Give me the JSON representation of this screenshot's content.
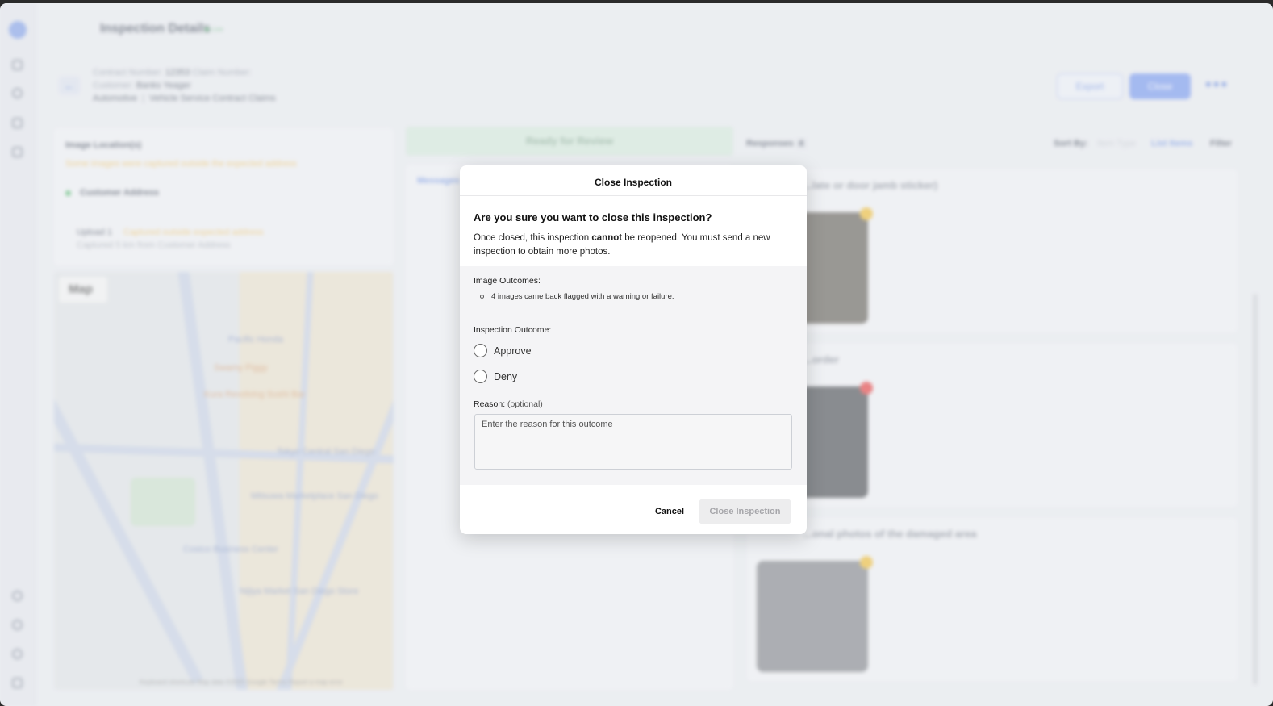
{
  "header": {
    "title": "Inspection Details",
    "live_badge": "Live",
    "contract_number_label": "Contract Number:",
    "contract_number": "12353",
    "claim_number_label": "Claim Number:",
    "customer_label": "Customer:",
    "customer_name": "Banks Yeager",
    "category": "Automotive",
    "program": "Vehicle Service Contract Claims",
    "export_label": "Export",
    "close_label": "Close"
  },
  "location_panel": {
    "title": "Image Location(s)",
    "warning": "Some images were captured outside the expected address",
    "customer_address": "Customer Address",
    "upload_label": "Upload 1",
    "upload_warning": "Captured outside expected address",
    "upload_distance": "Captured 5 km from Customer Address"
  },
  "map": {
    "type_button": "Map",
    "labels": [
      "Pacific Honda",
      "Swamy Piggy",
      "Kura Revolving Sushi Bar",
      "Tokyo Central San Diego",
      "Mitsuwa Marketplace San Diego",
      "Costco Business Center",
      "Target",
      "Nijiya Market San Diego Store",
      "Lindbergh Park",
      "Jack in the Box"
    ],
    "footer": "Keyboard shortcuts   Map data ©2025 Google   Terms   Report a map error"
  },
  "status": {
    "label": "Ready for Review",
    "color": "#5cbc75"
  },
  "messages_tab": "Messages",
  "responses": {
    "title": "Responses",
    "count": "4",
    "sort_by": "Sort By:",
    "sort_item_type": "Item Type",
    "sort_list_items": "List Items",
    "filter": "Filter"
  },
  "cards": [
    {
      "title": "...late or door jamb sticker)",
      "flag_color": "#f0c040"
    },
    {
      "title": "...order",
      "flag_color": "#e84a4a"
    },
    {
      "title": "...onal photos of the damaged area",
      "flag_color": "#f0c040"
    }
  ],
  "modal": {
    "title": "Close Inspection",
    "question": "Are you sure you want to close this inspection?",
    "desc_before": "Once closed, this inspection ",
    "desc_bold": "cannot",
    "desc_after": " be reopened. You must send a new inspection to obtain more photos.",
    "image_outcomes_label": "Image Outcomes:",
    "image_outcome_item": "4 images came back flagged with a warning or failure.",
    "inspection_outcome_label": "Inspection Outcome:",
    "option_approve": "Approve",
    "option_deny": "Deny",
    "reason_label": "Reason:",
    "reason_optional": "(optional)",
    "reason_placeholder": "Enter the reason for this outcome",
    "cancel_label": "Cancel",
    "confirm_label": "Close Inspection"
  }
}
